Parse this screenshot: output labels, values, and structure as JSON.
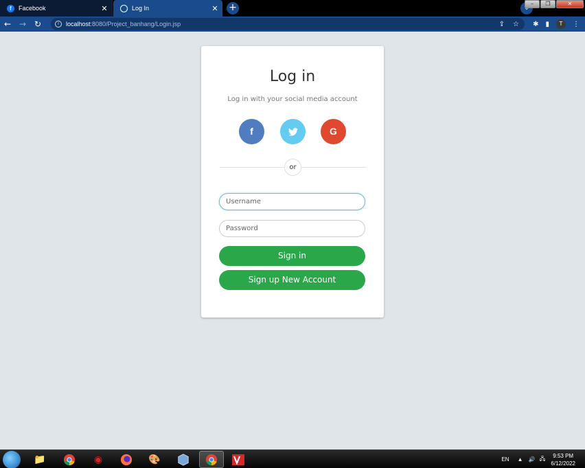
{
  "browser": {
    "tabs": [
      {
        "title": "Facebook",
        "icon": "facebook-icon"
      },
      {
        "title": "Log In",
        "icon": "globe-icon",
        "active": true
      }
    ],
    "address": {
      "host": "localhost",
      "path": ":8080/Project_banhang/Login.jsp"
    },
    "profile_initial": "T"
  },
  "login": {
    "title": "Log in",
    "subtitle": "Log in with your social media account",
    "social": [
      {
        "name": "facebook",
        "glyph": "f"
      },
      {
        "name": "twitter",
        "glyph": "🐦"
      },
      {
        "name": "google",
        "glyph": "G"
      }
    ],
    "divider_text": "or",
    "username_placeholder": "Username",
    "password_placeholder": "Password",
    "signin_label": "Sign in",
    "signup_label": "Sign up New Account"
  },
  "taskbar": {
    "language": "EN",
    "time": "9:53 PM",
    "date": "6/12/2022"
  },
  "colors": {
    "accent_green": "#2aa748",
    "facebook": "#507cc0",
    "twitter": "#64ccf1",
    "google": "#df4930",
    "page_bg": "#dfe5e8"
  }
}
